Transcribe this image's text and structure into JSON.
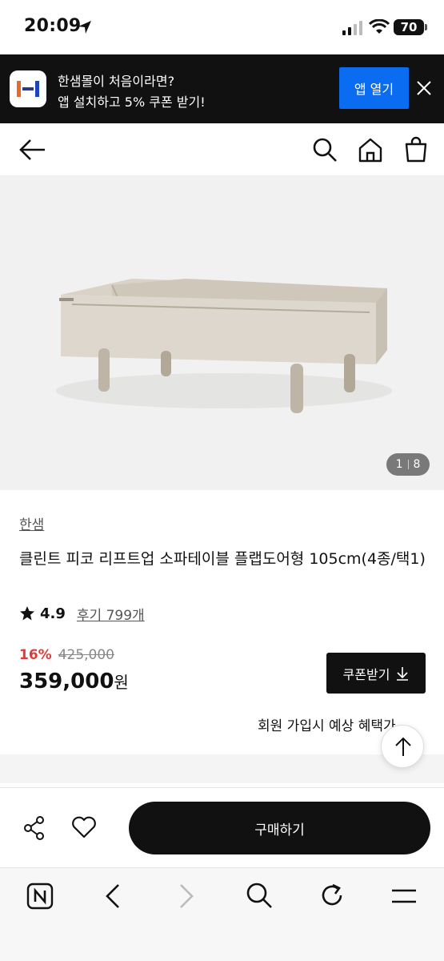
{
  "status_bar": {
    "time": "20:09",
    "battery": "70"
  },
  "app_banner": {
    "line1": "한샘몰이 처음이라면?",
    "line2": "앱 설치하고 5% 쿠폰 받기!",
    "open_button": "앱 열기"
  },
  "product": {
    "image_counter": {
      "current": "1",
      "total": "8"
    },
    "brand": "한샘",
    "title": "클린트 피코 리프트업 소파테이블 플랩도어형 105cm(4종/택1)",
    "rating": "4.9",
    "review_link": "후기 799개",
    "discount": "16%",
    "original_price": "425,000",
    "price": "359,000",
    "price_unit": "원",
    "coupon_button": "쿠폰받기",
    "member_benefit": "회원 가입시 예상 혜택가"
  },
  "purchase_bar": {
    "buy_button": "구매하기"
  },
  "colors": {
    "banner_bg": "#111111",
    "open_app": "#0a6cf0",
    "discount": "#e03a3a",
    "buy": "#111111"
  }
}
